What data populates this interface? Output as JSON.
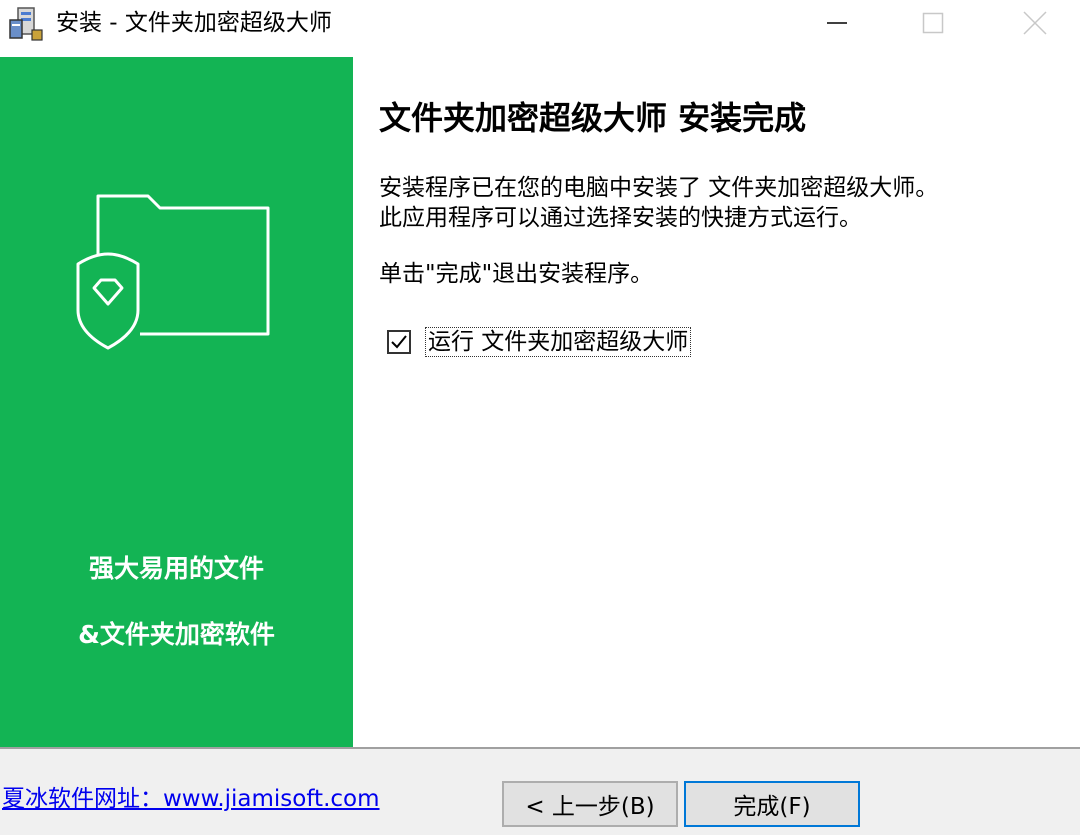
{
  "window": {
    "title": "安装 - 文件夹加密超级大师"
  },
  "side_panel": {
    "tagline_line1": "强大易用的文件",
    "tagline_line2": "&文件夹加密软件",
    "background_color": "#13b454"
  },
  "main": {
    "heading": "文件夹加密超级大师 安装完成",
    "paragraph1_line1": "安装程序已在您的电脑中安装了 文件夹加密超级大师。",
    "paragraph1_line2": "此应用程序可以通过选择安装的快捷方式运行。",
    "paragraph2": "单击\"完成\"退出安装程序。",
    "run_checkbox": {
      "label": "运行 文件夹加密超级大师",
      "checked": true
    }
  },
  "footer": {
    "site_link": "夏冰软件网址：www.jiamisoft.com",
    "back_button": "< 上一步(B)",
    "finish_button": "完成(F)"
  }
}
